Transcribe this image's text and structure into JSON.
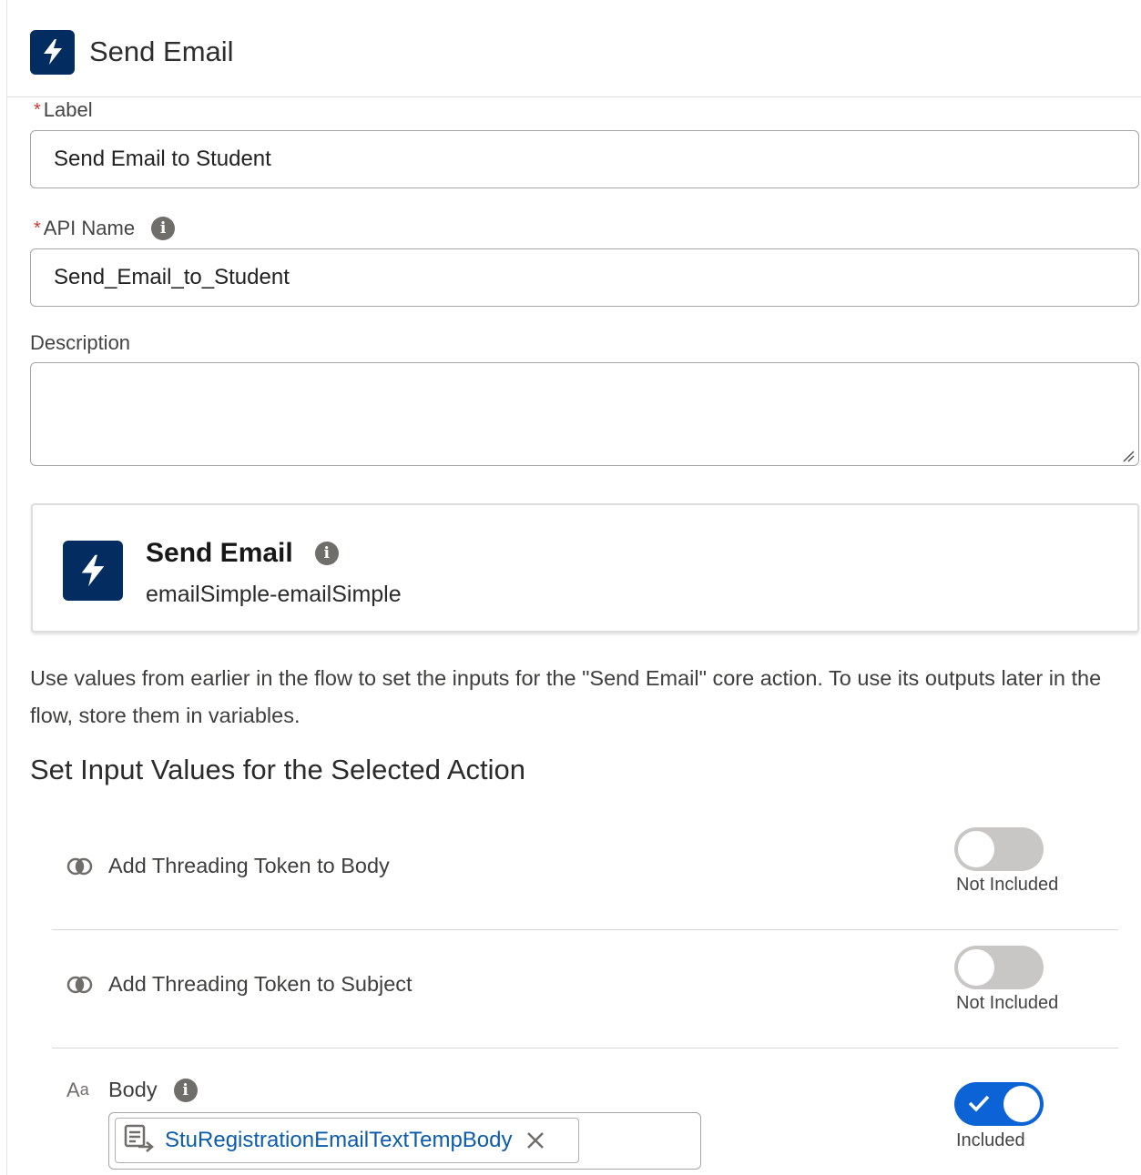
{
  "header": {
    "title": "Send Email",
    "icon": "lightning-icon",
    "tile_color": "#032d60"
  },
  "form": {
    "label_field": {
      "label": "Label",
      "required_mark": "*",
      "value": "Send Email to Student"
    },
    "api_name_field": {
      "label": "API Name",
      "required_mark": "*",
      "value": "Send_Email_to_Student",
      "info_glyph": "i"
    },
    "description_field": {
      "label": "Description",
      "value": ""
    }
  },
  "action_card": {
    "title": "Send Email",
    "subtitle": "emailSimple-emailSimple",
    "info_glyph": "i",
    "icon": "lightning-icon"
  },
  "help_text": "Use values from earlier in the flow to set the inputs for the \"Send Email\" core action. To use its outputs later in the flow, store them in variables.",
  "section_title": "Set Input Values for the Selected Action",
  "inputs": [
    {
      "label": "Add Threading Token to Body",
      "type_icon": "boolean-icon",
      "included": false,
      "state_label": "Not Included"
    },
    {
      "label": "Add Threading Token to Subject",
      "type_icon": "boolean-icon",
      "included": false,
      "state_label": "Not Included"
    },
    {
      "label": "Body",
      "type_icon": "text-type-icon",
      "type_glyph": "A",
      "type_glyph_sub": "a",
      "info_glyph": "i",
      "included": true,
      "state_label": "Included",
      "value_pill": "StuRegistrationEmailTextTempBody",
      "value_icon": "text-template-icon"
    }
  ],
  "colors": {
    "toggle_on": "#0b63d6",
    "toggle_off": "#c9c7c5",
    "link_blue": "#0b5cab",
    "required_red": "#c23934"
  }
}
